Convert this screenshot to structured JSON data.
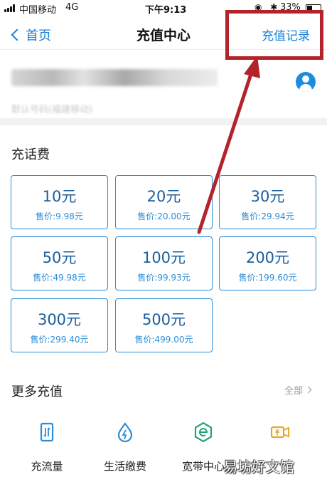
{
  "status_bar": {
    "carrier": "中国移动",
    "network": "4G",
    "time": "下午9:13",
    "icons": "◉ ✱",
    "battery": "33%"
  },
  "nav": {
    "back_label": "首页",
    "title": "充值中心",
    "records_label": "充值记录"
  },
  "account": {
    "blurred_subtitle": "默认号码(福建移动)"
  },
  "topup": {
    "section_title": "充话费",
    "options": [
      {
        "amount": "10元",
        "price": "售价:9.98元"
      },
      {
        "amount": "20元",
        "price": "售价:20.00元"
      },
      {
        "amount": "30元",
        "price": "售价:29.94元"
      },
      {
        "amount": "50元",
        "price": "售价:49.98元"
      },
      {
        "amount": "100元",
        "price": "售价:99.93元"
      },
      {
        "amount": "200元",
        "price": "售价:199.60元"
      },
      {
        "amount": "300元",
        "price": "售价:299.40元"
      },
      {
        "amount": "500元",
        "price": "售价:499.00元"
      }
    ]
  },
  "more": {
    "section_title": "更多充值",
    "all_label": "全部",
    "services": [
      {
        "label": "充流量",
        "icon": "data-card-icon",
        "color": "#2d8dd6"
      },
      {
        "label": "生活缴费",
        "icon": "water-drop-icon",
        "color": "#2d8dd6"
      },
      {
        "label": "宽带中心",
        "icon": "broadband-e-icon",
        "color": "#23a37a"
      },
      {
        "label": "",
        "icon": "video-ticket-icon",
        "color": "#e6a72a"
      }
    ]
  },
  "watermark": "易坊好文馆",
  "colors": {
    "accent": "#1a7fd4",
    "tile_border": "#2d8dd6",
    "annotation_red": "#b3242a"
  }
}
